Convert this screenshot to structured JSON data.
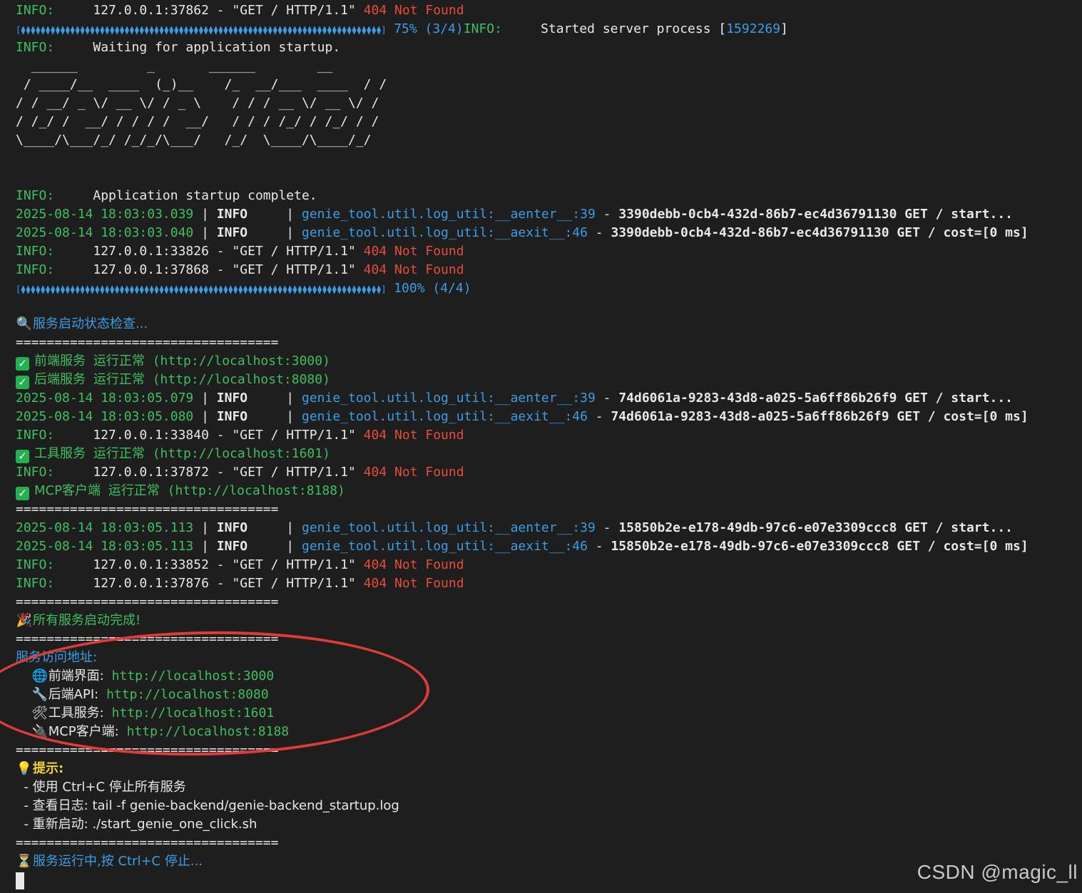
{
  "log": {
    "l1": {
      "prefix": "INFO:",
      "addr": "127.0.0.1:37862 - \"GET / HTTP/1.1\"",
      "status": "404 Not Found"
    },
    "l2": {
      "bar": "[⧫⧫⧫⧫⧫⧫⧫⧫⧫⧫⧫⧫⧫⧫⧫⧫⧫⧫⧫⧫⧫⧫⧫⧫⧫⧫⧫⧫⧫⧫⧫⧫⧫⧫⧫⧫⧫⧫⧫⧫⧫⧫⧫⧫⧫⧫⧫⧫⧫⧫⧫⧫⧫⧫⧫⧫⧫⧫⧫⧫⧫⧫⧫⧫⧫⧫⧫⧫⧫⧫⧫⧫⧫]",
      "progress": "75% (3/4)",
      "prefix": "INFO:",
      "text": "Started server process [",
      "pid": "1592269",
      "close": "]"
    },
    "l3": {
      "prefix": "INFO:",
      "text": "Waiting for application startup."
    },
    "ascii": [
      "  ______         _       ______        __",
      " / ____/__  ____  (_)__    /_  __/___  ____  / /",
      "/ / __/ _ \\/ __ \\/ / _ \\    / / / __ \\/ __ \\/ /",
      "/ /_/ /  __/ / / / /  __/   / / / /_/ / /_/ / /",
      "\\____/\\___/_/ /_/_/\\___/   /_/  \\____/\\____/_/"
    ],
    "l4": {
      "prefix": "INFO:",
      "text": "Application startup complete."
    },
    "l5": {
      "ts": "2025-08-14 18:03:03.039",
      "level": "INFO",
      "mod": "genie_tool.util.log_util:__aenter__:39",
      "msg": "3390debb-0cb4-432d-86b7-ec4d36791130 GET / start..."
    },
    "l6": {
      "ts": "2025-08-14 18:03:03.040",
      "level": "INFO",
      "mod": "genie_tool.util.log_util:__aexit__:46",
      "msg": "3390debb-0cb4-432d-86b7-ec4d36791130 GET / cost=[0 ms]"
    },
    "l7": {
      "prefix": "INFO:",
      "addr": "127.0.0.1:33826 - \"GET / HTTP/1.1\"",
      "status": "404 Not Found"
    },
    "l8": {
      "prefix": "INFO:",
      "addr": "127.0.0.1:37868 - \"GET / HTTP/1.1\"",
      "status": "404 Not Found"
    },
    "l9": {
      "bar": "[⧫⧫⧫⧫⧫⧫⧫⧫⧫⧫⧫⧫⧫⧫⧫⧫⧫⧫⧫⧫⧫⧫⧫⧫⧫⧫⧫⧫⧫⧫⧫⧫⧫⧫⧫⧫⧫⧫⧫⧫⧫⧫⧫⧫⧫⧫⧫⧫⧫⧫⧫⧫⧫⧫⧫⧫⧫⧫⧫⧫⧫⧫⧫⧫⧫⧫⧫⧫⧫⧫⧫⧫⧫]",
      "progress": "100% (4/4)"
    },
    "check_title": "服务启动状态检查...",
    "sep": "==================================",
    "ok1": {
      "name": "前端服务",
      "status": "运行正常",
      "url": "(http://localhost:3000)"
    },
    "ok2": {
      "name": "后端服务",
      "status": "运行正常",
      "url": "(http://localhost:8080)"
    },
    "l10": {
      "ts": "2025-08-14 18:03:05.079",
      "level": "INFO",
      "mod": "genie_tool.util.log_util:__aenter__:39",
      "msg": "74d6061a-9283-43d8-a025-5a6ff86b26f9 GET / start..."
    },
    "l11": {
      "ts": "2025-08-14 18:03:05.080",
      "level": "INFO",
      "mod": "genie_tool.util.log_util:__aexit__:46",
      "msg": "74d6061a-9283-43d8-a025-5a6ff86b26f9 GET / cost=[0 ms]"
    },
    "l12": {
      "prefix": "INFO:",
      "addr": "127.0.0.1:33840 - \"GET / HTTP/1.1\"",
      "status": "404 Not Found"
    },
    "ok3": {
      "name": "工具服务",
      "status": "运行正常",
      "url": "(http://localhost:1601)"
    },
    "l13": {
      "prefix": "INFO:",
      "addr": "127.0.0.1:37872 - \"GET / HTTP/1.1\"",
      "status": "404 Not Found"
    },
    "ok4": {
      "name": "MCP客户端",
      "status": "运行正常",
      "url": "(http://localhost:8188)"
    },
    "l14": {
      "ts": "2025-08-14 18:03:05.113",
      "level": "INFO",
      "mod": "genie_tool.util.log_util:__aenter__:39",
      "msg": "15850b2e-e178-49db-97c6-e07e3309ccc8 GET / start..."
    },
    "l15": {
      "ts": "2025-08-14 18:03:05.113",
      "level": "INFO",
      "mod": "genie_tool.util.log_util:__aexit__:46",
      "msg": "15850b2e-e178-49db-97c6-e07e3309ccc8 GET / cost=[0 ms]"
    },
    "l16": {
      "prefix": "INFO:",
      "addr": "127.0.0.1:33852 - \"GET / HTTP/1.1\"",
      "status": "404 Not Found"
    },
    "l17": {
      "prefix": "INFO:",
      "addr": "127.0.0.1:37876 - \"GET / HTTP/1.1\"",
      "status": "404 Not Found"
    },
    "done": "所有服务启动完成!",
    "access_title": "服务访问地址:",
    "urls": [
      {
        "label": "前端界面:",
        "url": "http://localhost:3000",
        "icon": "globe-icon"
      },
      {
        "label": "后端API:",
        "url": "http://localhost:8080",
        "icon": "wrench-icon"
      },
      {
        "label": "工具服务:",
        "url": "http://localhost:1601",
        "icon": "tools-icon"
      },
      {
        "label": "MCP客户端:",
        "url": "http://localhost:8188",
        "icon": "plug-icon"
      }
    ],
    "tip_title": "提示:",
    "tips": [
      "- 使用 Ctrl+C 停止所有服务",
      "- 查看日志: tail -f genie-backend/genie-backend_startup.log",
      "- 重新启动: ./start_genie_one_click.sh"
    ],
    "running": "服务运行中,按 Ctrl+C 停止..."
  },
  "watermark": "CSDN @magic_ll",
  "colors": {
    "bg": "#1e1e1e",
    "green": "#3fbf5f",
    "cyan": "#3b9de6",
    "red": "#e74c3c",
    "annotation": "#e03a3a"
  }
}
